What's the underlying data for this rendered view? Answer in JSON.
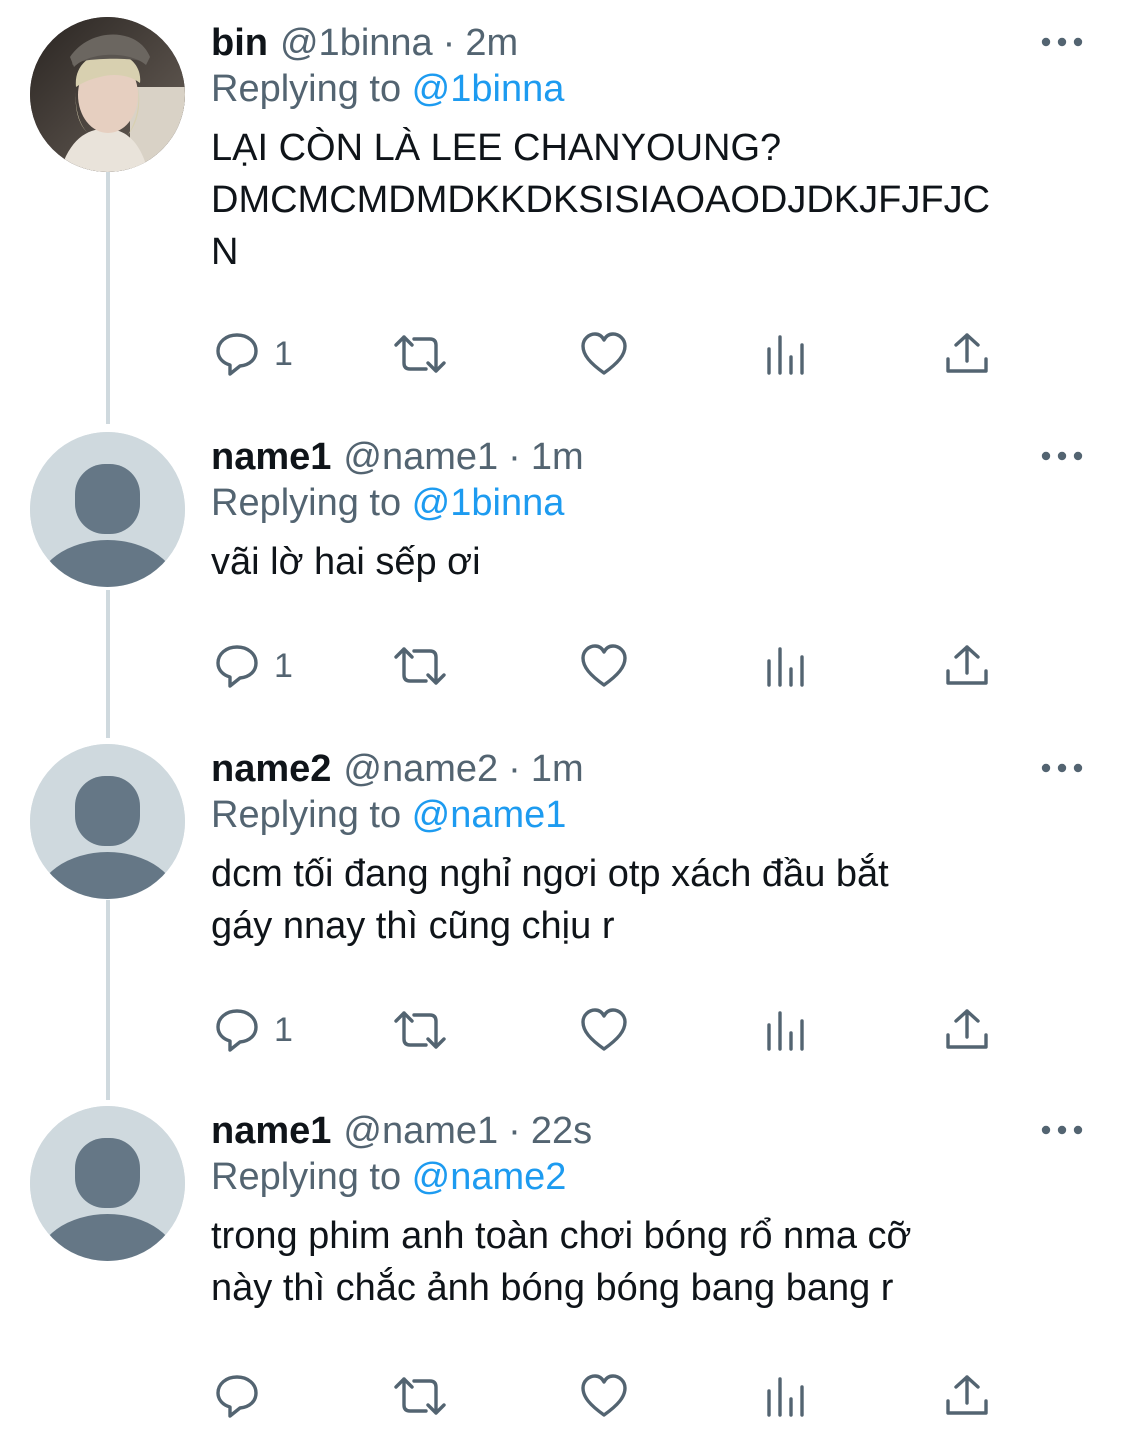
{
  "tweets": [
    {
      "name": "bin",
      "handle": "@1binna",
      "separator": "·",
      "time": "2m",
      "replying_prefix": "Replying to ",
      "replying_to": "@1binna",
      "text": "LẠI CÒN LÀ LEE CHANYOUNG?\nDMCMCMDMDKKDKSISIAOAODJDKJFJFJC\nN",
      "reply_count": "1",
      "avatar": "photo"
    },
    {
      "name": "name1",
      "handle": "@name1",
      "separator": "·",
      "time": "1m",
      "replying_prefix": "Replying to ",
      "replying_to": "@1binna",
      "text": "vãi lờ hai sếp ơi",
      "reply_count": "1",
      "avatar": "default-profile"
    },
    {
      "name": "name2",
      "handle": "@name2",
      "separator": "·",
      "time": "1m",
      "replying_prefix": "Replying to ",
      "replying_to": "@name1",
      "text": "dcm tối đang nghỉ ngơi otp xách đầu bắt\ngáy nnay thì cũng chịu r",
      "reply_count": "1",
      "avatar": "default-profile"
    },
    {
      "name": "name1",
      "handle": "@name1",
      "separator": "·",
      "time": "22s",
      "replying_prefix": "Replying to ",
      "replying_to": "@name2",
      "text": "trong phim anh toàn chơi bóng rổ nma cỡ\nnày thì chắc ảnh bóng bóng bang bang r",
      "reply_count": "",
      "avatar": "default-profile"
    }
  ],
  "icons": {
    "reply": "speech-bubble-icon",
    "retweet": "retweet-arrows-icon",
    "like": "heart-icon",
    "views": "bar-chart-icon",
    "share": "share-upload-icon",
    "more": "ellipsis-icon"
  },
  "colors": {
    "text": "#0f1419",
    "secondary": "#536471",
    "link": "#1d9bf0",
    "thread_line": "#cfd9de",
    "avatar_bg": "#cfd9de",
    "avatar_fg": "#657786"
  }
}
